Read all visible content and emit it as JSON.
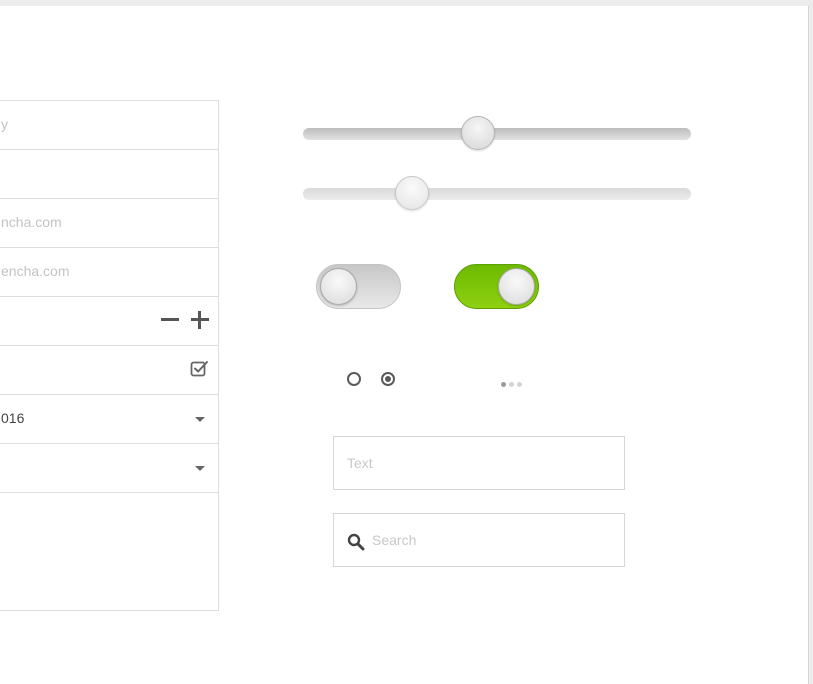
{
  "form": {
    "rows": [
      {
        "text": "y",
        "placeholder": true
      },
      {
        "text": "",
        "placeholder": true
      },
      {
        "text": "ncha.com",
        "placeholder": true
      },
      {
        "text": "encha.com",
        "placeholder": true
      },
      {
        "text": "",
        "placeholder": false,
        "control": "stepper"
      },
      {
        "text": "",
        "placeholder": false,
        "control": "checkbox",
        "checked": true
      },
      {
        "text": "016",
        "placeholder": false,
        "control": "dropdown"
      },
      {
        "text": "",
        "placeholder": false,
        "control": "dropdown"
      }
    ]
  },
  "sliders": [
    {
      "value": 0.45
    },
    {
      "value": 0.28
    }
  ],
  "toggles": [
    {
      "state": "off"
    },
    {
      "state": "on"
    }
  ],
  "radios": [
    {
      "checked": false
    },
    {
      "checked": true
    }
  ],
  "pager": {
    "count": 3,
    "active_index": 0
  },
  "text_field": {
    "placeholder": "Text",
    "value": ""
  },
  "search_field": {
    "placeholder": "Search",
    "value": "",
    "icon": "search-icon"
  },
  "colors": {
    "toggle_on": "#7dc300",
    "border": "#dddddd",
    "placeholder": "#c3c3c3"
  }
}
